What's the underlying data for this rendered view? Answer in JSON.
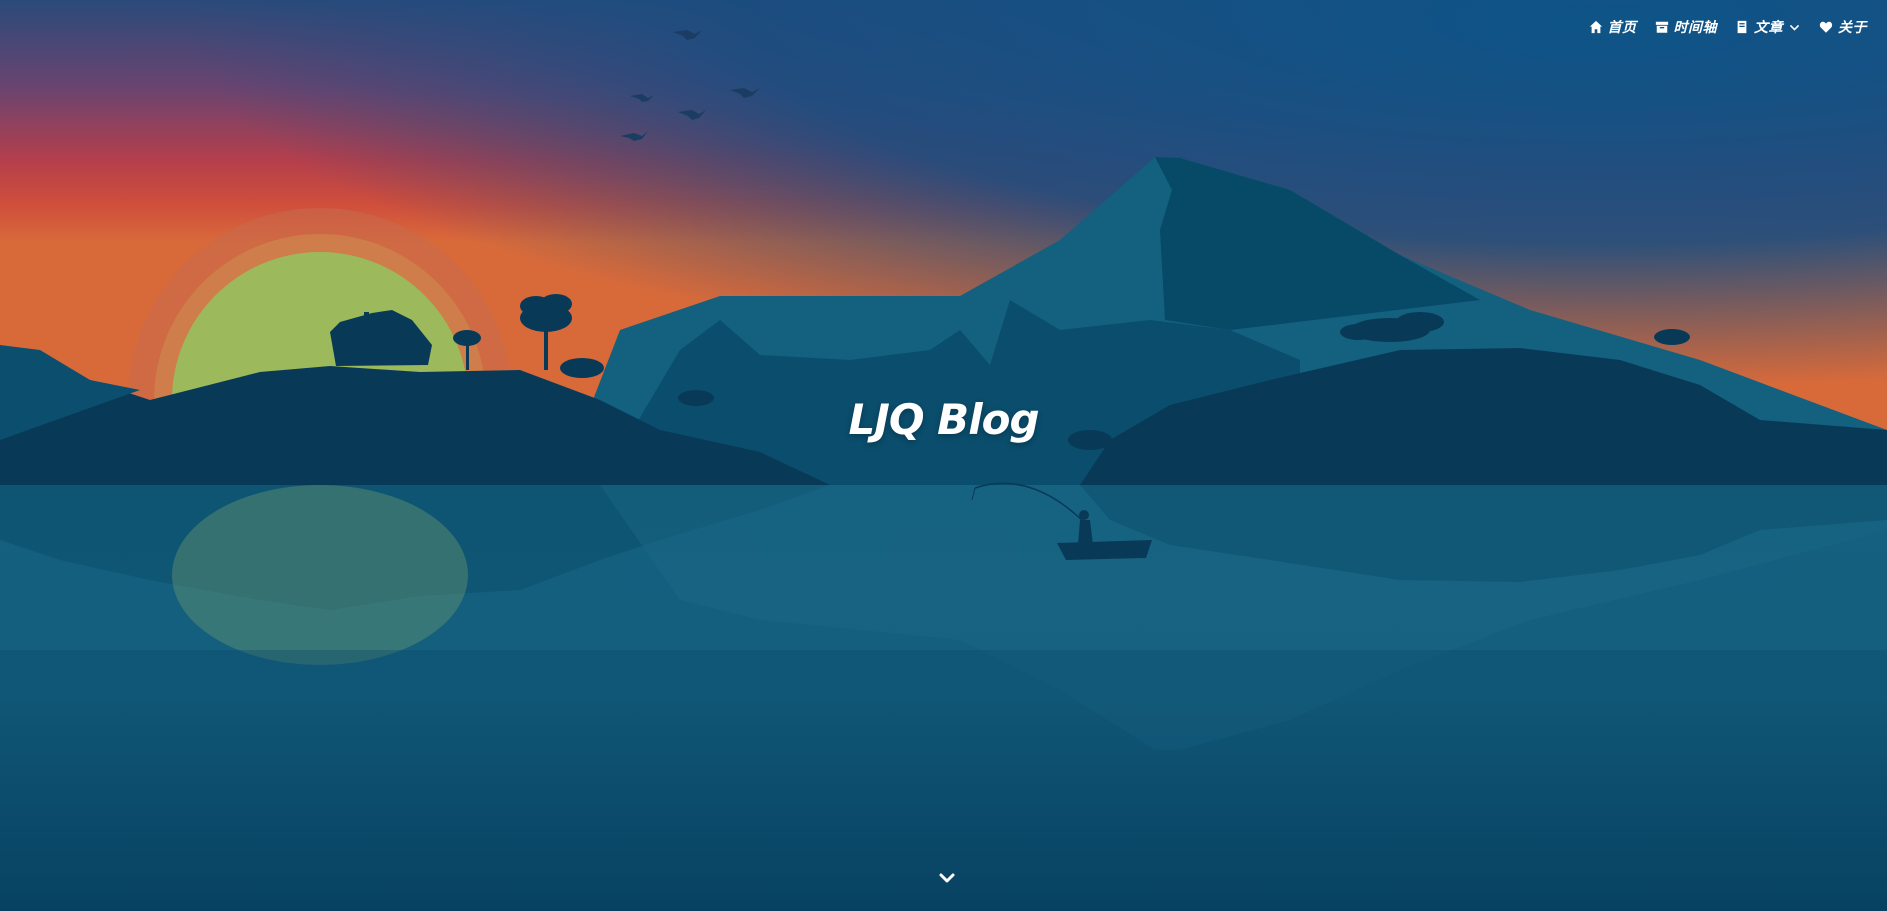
{
  "site": {
    "title": "LJQ Blog"
  },
  "nav": {
    "items": [
      {
        "label": "首页",
        "icon": "home-icon"
      },
      {
        "label": "时间轴",
        "icon": "archive-icon"
      },
      {
        "label": "文章",
        "icon": "book-icon",
        "has_dropdown": true
      },
      {
        "label": "关于",
        "icon": "heart-icon"
      }
    ]
  },
  "hero": {
    "scroll_icon": "chevron-down-icon",
    "colors": {
      "sky_top": "#0f4f82",
      "sky_sunset": "#c2404a",
      "sun": "#9cb95c",
      "mountain": "#10607e",
      "island": "#083a58",
      "water": "#0d5a7a"
    }
  }
}
